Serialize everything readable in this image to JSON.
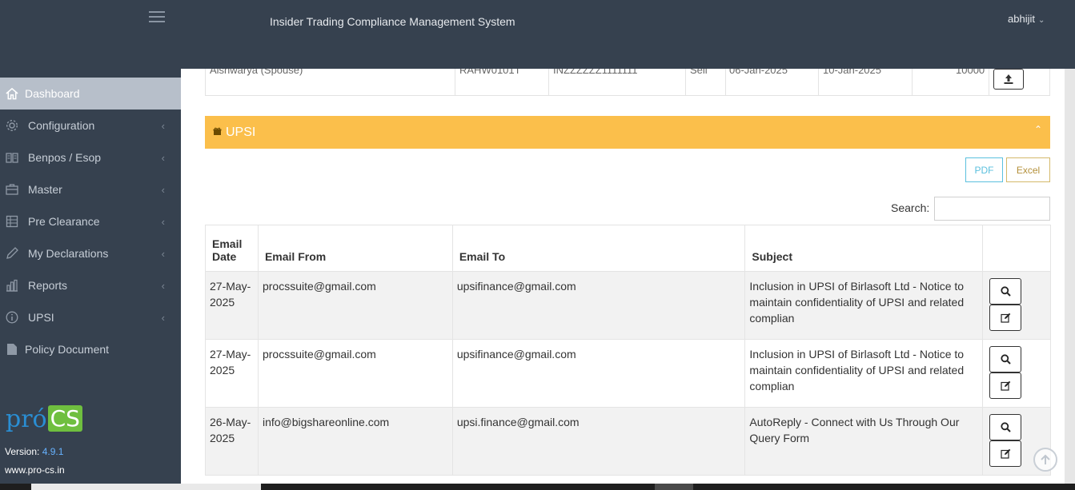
{
  "header": {
    "app_title": "Insider Trading Compliance Management System",
    "user_name": "abhijit"
  },
  "sidebar": {
    "items": [
      {
        "label": "Dashboard",
        "icon": "home-icon",
        "active": true
      },
      {
        "label": "Configuration",
        "icon": "gear-icon"
      },
      {
        "label": "Benpos / Esop",
        "icon": "book-icon"
      },
      {
        "label": "Master",
        "icon": "briefcase-icon"
      },
      {
        "label": "Pre Clearance",
        "icon": "table-icon"
      },
      {
        "label": "My Declarations",
        "icon": "pencil-icon"
      },
      {
        "label": "Reports",
        "icon": "bar-chart-icon"
      },
      {
        "label": "UPSI",
        "icon": "info-icon"
      },
      {
        "label": "Policy Document",
        "icon": "document-icon"
      }
    ],
    "brand_pro": "pró",
    "brand_cs": "CS",
    "version_label": "Version:",
    "version_number": "4.9.1",
    "website": "www.pro-cs.in"
  },
  "prev_row": {
    "name": "Aishwarya (Spouse)",
    "pan": "RAHW0101T",
    "isin": "INZZZZZZ1111111",
    "type": "Sell",
    "from_date": "06-Jan-2025",
    "to_date": "10-Jan-2025",
    "qty": "10000"
  },
  "upsi": {
    "title": "UPSI",
    "pdf_label": "PDF",
    "excel_label": "Excel",
    "search_label": "Search:",
    "search_value": "",
    "columns": {
      "email_date": "Email Date",
      "email_from": "Email From",
      "email_to": "Email To",
      "subject": "Subject"
    },
    "rows": [
      {
        "date": "27-May-2025",
        "from": "procssuite@gmail.com",
        "to": "upsifinance@gmail.com",
        "subject": "Inclusion in UPSI of Birlasoft Ltd - Notice to maintain confidentiality of UPSI and related complian"
      },
      {
        "date": "27-May-2025",
        "from": "procssuite@gmail.com",
        "to": "upsifinance@gmail.com",
        "subject": "Inclusion in UPSI of Birlasoft Ltd - Notice to maintain confidentiality of UPSI and related complian"
      },
      {
        "date": "26-May-2025",
        "from": "info@bigshareonline.com",
        "to": "upsi.finance@gmail.com",
        "subject": "AutoReply - Connect with Us Through Our Query Form"
      }
    ]
  },
  "colors": {
    "sidebar_bg": "#36414f",
    "active_bg": "#b7bfca",
    "upsi_bar": "#fbbf4b",
    "pdf": "#5bc0de",
    "version": "#66b2ff"
  }
}
